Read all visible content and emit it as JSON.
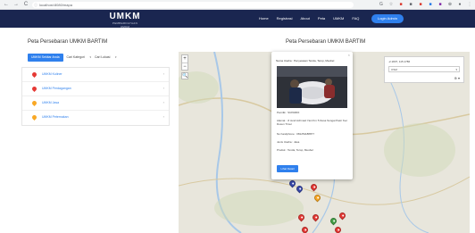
{
  "browser": {
    "url": "localhost:8080/mapa",
    "nav_icons": [
      {
        "name": "back-icon",
        "glyph": "←"
      },
      {
        "name": "forward-icon",
        "glyph": "→"
      },
      {
        "name": "reload-icon",
        "glyph": "C"
      },
      {
        "name": "info-icon",
        "glyph": "ⓘ"
      }
    ],
    "extensions": [
      {
        "name": "translate-icon",
        "glyph": "G",
        "color": "#5f6368"
      },
      {
        "name": "star-icon",
        "glyph": "☆",
        "color": "#5f6368"
      },
      {
        "name": "extension-red-icon",
        "glyph": "■",
        "color": "#d93025"
      },
      {
        "name": "extension-gray-icon",
        "glyph": "■",
        "color": "#5f6368"
      },
      {
        "name": "extension-red2-icon",
        "glyph": "■",
        "color": "#d93025"
      },
      {
        "name": "extension-blue-icon",
        "glyph": "■",
        "color": "#1a73e8"
      },
      {
        "name": "extension-purple-icon",
        "glyph": "■",
        "color": "#7b1fa2"
      },
      {
        "name": "puzzle-icon",
        "glyph": "⊕",
        "color": "#5f6368"
      },
      {
        "name": "profile-icon",
        "glyph": "●",
        "color": "#5f6368"
      },
      {
        "name": "menu-icon",
        "glyph": "⋮",
        "color": "#5f6368"
      }
    ]
  },
  "navbar": {
    "brand": "UMKM",
    "brand_sub": "PEMBERDAYAAN UMKM",
    "menu": [
      "Home",
      "Registrasi",
      "About",
      "Peta",
      "UMKM",
      "FAQ"
    ],
    "login_button": "Login Admin"
  },
  "left_panel": {
    "title": "Peta Persebaran UMKM BARTIM",
    "button": "UMKM Sekitar Anda",
    "category_select": "Cari Kategori",
    "location_select": "Cari Lokasi",
    "categories": [
      {
        "label": "UMKM Kuliner",
        "color": "#e53935"
      },
      {
        "label": "UMKM Perdagangan",
        "color": "#e53935"
      },
      {
        "label": "UMKM Jasa",
        "color": "#f9a825"
      },
      {
        "label": "UMKM Peternakan",
        "color": "#f9a825"
      }
    ]
  },
  "map": {
    "title": "Peta Persebaran UMKM BARTIM",
    "zoom_in": "+",
    "zoom_out": "−",
    "search_glyph": "🔍",
    "coordinate_text": "-2.1837, 115.1786",
    "coordinate_select": "OSM",
    "coordinate_icon": "⊕ ▾",
    "colors": {
      "land": "#e8e6dc",
      "river": "#a8c8e8",
      "road": "#d8c9a0",
      "forest": "#cfd9b8"
    }
  },
  "popup": {
    "close": "×",
    "header": "Nama Usaha : Penyewaan Tenda, Terop, Meubel",
    "fields": [
      "Pemilik : SUPARDI",
      "Alamat : Jl Jend Achmad Yani Km 5 Desa Sungai Pasir Kec Dusun Timur",
      "No handphone : 081251188877",
      "Jenis Usaha : Jasa",
      "Produk : Tenda, Terop, Meubel"
    ],
    "button": "Lihat Detail"
  },
  "markers": [
    {
      "color": "#3949ab"
    },
    {
      "color": "#3949ab"
    },
    {
      "color": "#e53935"
    },
    {
      "color": "#f9a825"
    },
    {
      "color": "#e53935"
    },
    {
      "color": "#e53935"
    },
    {
      "color": "#43a047"
    },
    {
      "color": "#e53935"
    },
    {
      "color": "#e53935"
    },
    {
      "color": "#e53935"
    }
  ]
}
